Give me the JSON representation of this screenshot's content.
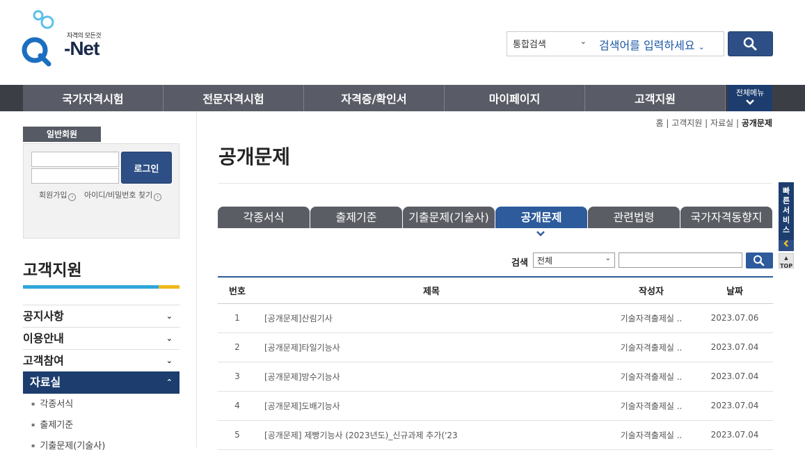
{
  "logo": {
    "tagline": "자격의 모든것",
    "name": "-Net"
  },
  "header": {
    "search_type": "통합검색",
    "search_placeholder": "검색어를 입력하세요"
  },
  "gnb": {
    "items": [
      "국가자격시험",
      "전문자격시험",
      "자격증/확인서",
      "마이페이지",
      "고객지원"
    ],
    "all_menu": "전체메뉴"
  },
  "login": {
    "tab": "일반회원",
    "button": "로그인",
    "join": "회원가입",
    "find": "아이디/비밀번호 찾기"
  },
  "lnb": {
    "title": "고객지원",
    "items": [
      "공지사항",
      "이용안내",
      "고객참여",
      "자료실"
    ],
    "sub_items": [
      "각종서식",
      "출제기준",
      "기출문제(기술사)"
    ]
  },
  "breadcrumb": {
    "home": "홈",
    "c1": "고객지원",
    "c2": "자료실",
    "current": "공개문제"
  },
  "page": {
    "title": "공개문제"
  },
  "tabs": [
    "각종서식",
    "출제기준",
    "기출문제(기술사)",
    "공개문제",
    "관련법령",
    "국가자격동향지"
  ],
  "filter": {
    "label": "검색",
    "selected": "전체"
  },
  "table": {
    "headers": [
      "번호",
      "제목",
      "작성자",
      "날짜"
    ],
    "rows": [
      {
        "no": "1",
        "title": "[공개문제]산림기사",
        "author": "기술자격출제실 ..",
        "date": "2023.07.06"
      },
      {
        "no": "2",
        "title": "[공개문제]타일기능사",
        "author": "기술자격출제실 ..",
        "date": "2023.07.04"
      },
      {
        "no": "3",
        "title": "[공개문제]방수기능사",
        "author": "기술자격출제실 ..",
        "date": "2023.07.04"
      },
      {
        "no": "4",
        "title": "[공개문제]도배기능사",
        "author": "기술자격출제실 ..",
        "date": "2023.07.04"
      },
      {
        "no": "5",
        "title": "[공개문제] 제빵기능사 (2023년도)_신규과제 추가('23",
        "author": "기술자격출제실 ..",
        "date": "2023.07.04"
      }
    ]
  },
  "quick": {
    "label": "빠른서비스",
    "top": "TOP"
  }
}
